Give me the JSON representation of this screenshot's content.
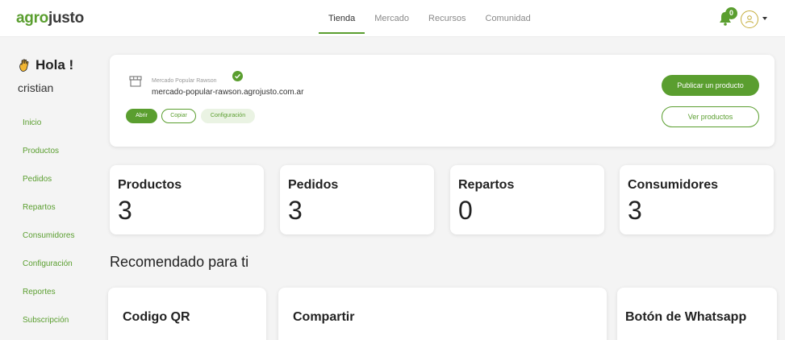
{
  "header": {
    "logo_part1": "agro",
    "logo_part2": "justo",
    "nav": [
      {
        "label": "Tienda",
        "active": true
      },
      {
        "label": "Mercado",
        "active": false
      },
      {
        "label": "Recursos",
        "active": false
      },
      {
        "label": "Comunidad",
        "active": false
      }
    ],
    "notifications_count": "0",
    "notification_icon": "bell-icon",
    "avatar_icon": "user-avatar-icon"
  },
  "sidebar": {
    "greeting": "Hola !",
    "greeting_icon": "waving-hand-icon",
    "username": "cristian",
    "items": [
      {
        "label": "Inicio"
      },
      {
        "label": "Productos"
      },
      {
        "label": "Pedidos"
      },
      {
        "label": "Repartos"
      },
      {
        "label": "Consumidores"
      },
      {
        "label": "Configuración"
      },
      {
        "label": "Reportes"
      },
      {
        "label": "Subscripción"
      }
    ]
  },
  "store": {
    "name": "Mercado Popular Rawson",
    "url": "mercado-popular-rawson.agrojusto.com.ar",
    "store_icon": "storefront-icon",
    "verified_icon": "check-circle-icon",
    "open_label": "Abrir",
    "copy_label": "Copiar",
    "config_label": "Configuración",
    "publish_label": "Publicar un producto",
    "view_label": "Ver productos"
  },
  "stats": [
    {
      "label": "Productos",
      "value": "3"
    },
    {
      "label": "Pedidos",
      "value": "3"
    },
    {
      "label": "Repartos",
      "value": "0"
    },
    {
      "label": "Consumidores",
      "value": "3"
    }
  ],
  "recommended": {
    "title": "Recomendado para ti",
    "cards": [
      {
        "label": "Codigo QR"
      },
      {
        "label": "Compartir"
      },
      {
        "label": "Botón de Whatsapp"
      }
    ]
  },
  "colors": {
    "accent": "#5a9e2f",
    "logo_dark": "#3a3a3a",
    "avatar_ring": "#c5ad3b"
  }
}
